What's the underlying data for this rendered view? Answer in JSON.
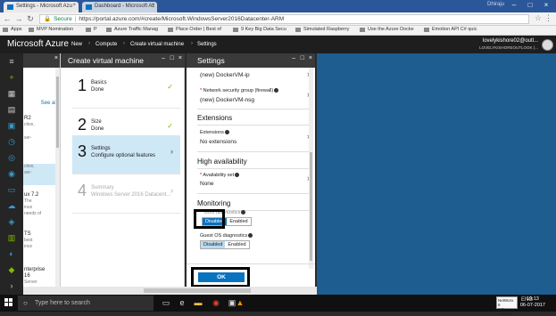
{
  "browser": {
    "tabs": [
      {
        "label": "Settings - Microsoft Azu"
      },
      {
        "label": "Dashboard - Microsoft Az"
      }
    ],
    "user_chip": "Dhiraju",
    "secure_label": "Secure",
    "url": "https://portal.azure.com/#create/Microsoft.WindowsServer2016Datacenter-ARM",
    "bookmarks": [
      "Apps",
      "MVP Nomination",
      "P",
      "Azure Traffic Manag",
      "Place Order | Best of",
      "9 Key Big Data Secu",
      "Simulated Raspberry",
      "Use the Azure Docke",
      "Emotion API C# quic"
    ]
  },
  "azure": {
    "brand": "Microsoft Azure",
    "breadcrumbs": [
      "New",
      "Compute",
      "Create virtual machine",
      "Settings"
    ],
    "user_name": "lovelykishore02@outl...",
    "user_directory": "LOVELYKISHOREOUTLOOK (..."
  },
  "partial_blade": {
    "see_all": "See all",
    "rows": [
      {
        "main": "R2",
        "sub": "ctive,"
      },
      {
        "main": "",
        "sub": "ser-"
      },
      {
        "main": "ctive,",
        "sub": "ser-"
      },
      {
        "main": "ux 7.2",
        "sub": "The"
      },
      {
        "main": "",
        "sub": "inux"
      },
      {
        "main": "",
        "sub": "needs of"
      },
      {
        "main": "TS",
        "sub": "best"
      },
      {
        "main": "",
        "sub": "ince"
      },
      {
        "main": "nterprise",
        "sub": "16"
      },
      {
        "main": "",
        "sub": "Server"
      }
    ]
  },
  "create_vm": {
    "title": "Create virtual machine",
    "steps": [
      {
        "num": "1",
        "name": "Basics",
        "desc": "Done"
      },
      {
        "num": "2",
        "name": "Size",
        "desc": "Done"
      },
      {
        "num": "3",
        "name": "Settings",
        "desc": "Configure optional features"
      },
      {
        "num": "4",
        "name": "Summary",
        "desc": "Windows Server 2016 Datacent..."
      }
    ]
  },
  "settings": {
    "title": "Settings",
    "public_ip_value": "(new) DockerVM-ip",
    "nsg_label": "Network security group (firewall)",
    "nsg_value": "(new) DockerVM-nsg",
    "extensions_section": "Extensions",
    "extensions_label": "Extensions",
    "extensions_value": "No extensions",
    "ha_section": "High availability",
    "availability_label": "Availability set",
    "availability_value": "None",
    "monitoring_section": "Monitoring",
    "boot_diag_label": "Boot diagnostics",
    "guest_diag_label": "Guest OS diagnostics",
    "toggle_disabled": "Disabled",
    "toggle_enabled": "Enabled",
    "ok_label": "OK"
  },
  "taskbar": {
    "search_placeholder": "Type here to search",
    "tooltip_line1": "NetWorx 6",
    "tooltip_line2": "not running",
    "time": "19:13",
    "date": "06-07-2017",
    "lang": "ENG"
  },
  "colors": {
    "azure_blue": "#1e5d8f",
    "accent": "#0a73c0",
    "check": "#6bb700"
  }
}
